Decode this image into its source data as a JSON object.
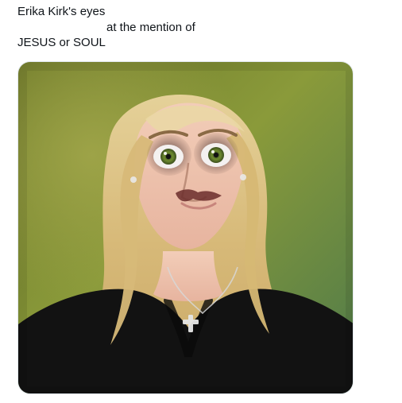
{
  "post": {
    "text_lines": [
      "Erika Kirk's eyes",
      "at the mention of",
      "JESUS or SOUL"
    ]
  },
  "media": {
    "type": "photo",
    "alt": ""
  },
  "colors": {
    "text": "#0f1419",
    "background": "#ffffff",
    "media_border": "#e1e8ed"
  }
}
